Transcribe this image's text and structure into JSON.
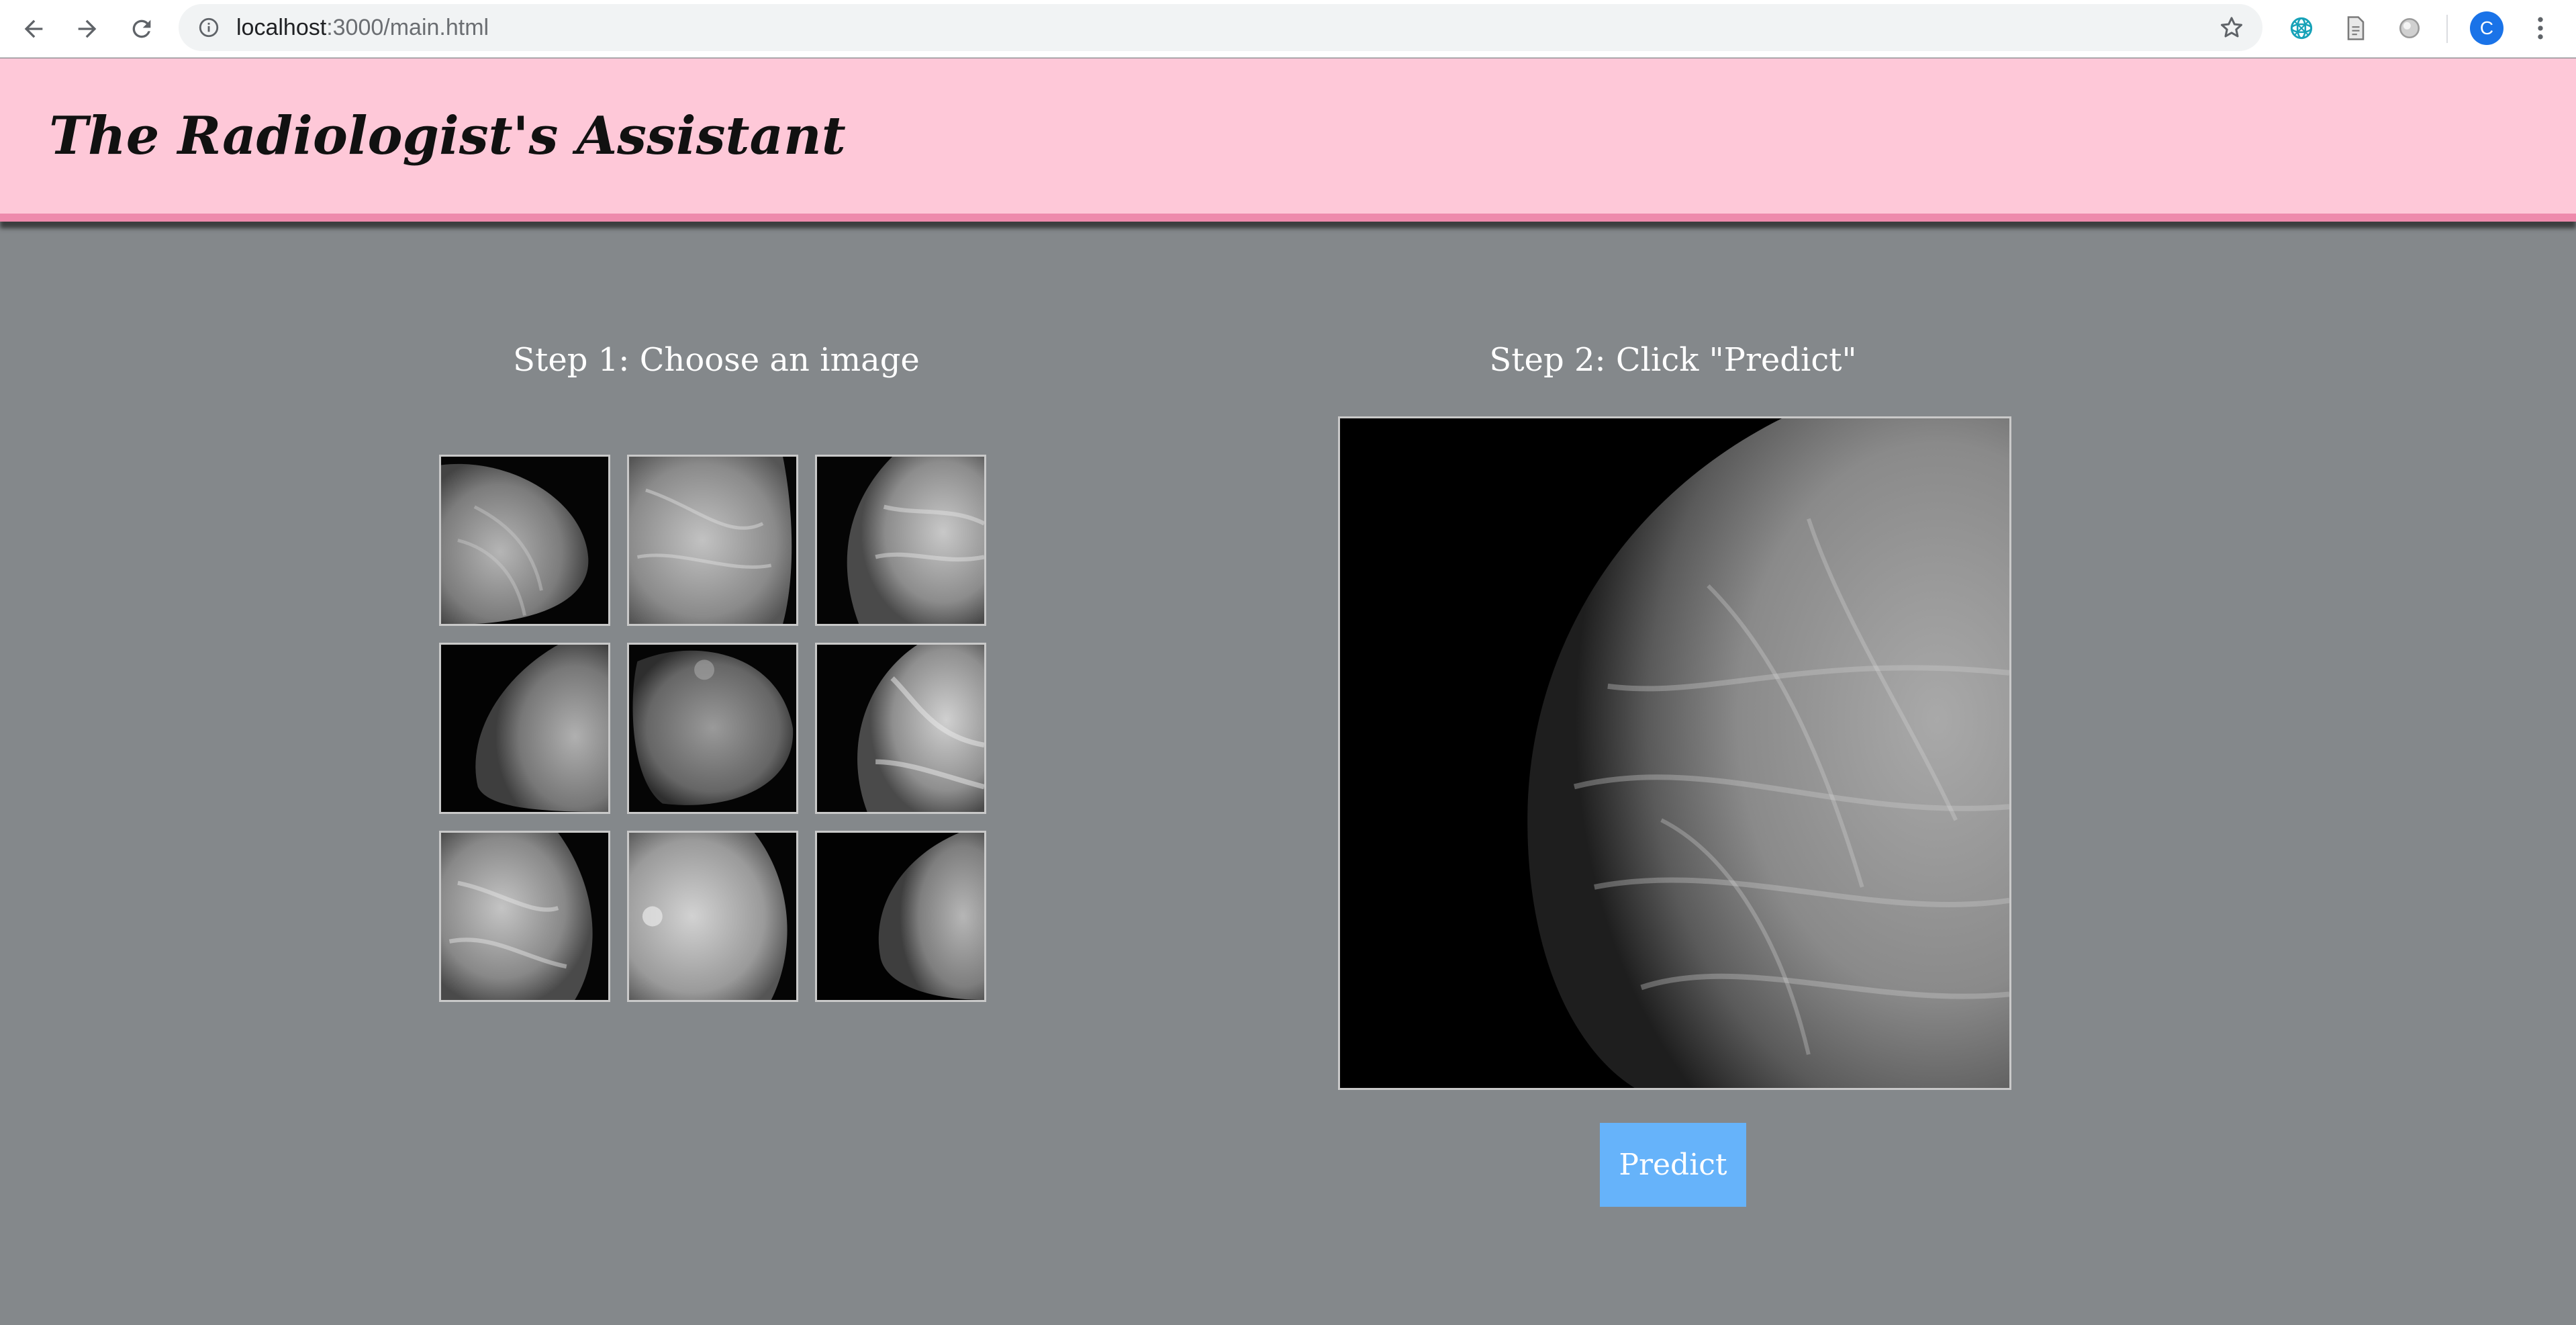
{
  "browser": {
    "url_host": "localhost",
    "url_rest": ":3000/main.html",
    "avatar_letter": "C",
    "icons": [
      "back-arrow-icon",
      "forward-arrow-icon",
      "reload-icon",
      "info-icon",
      "star-icon",
      "extension-icon",
      "document-icon",
      "circle-icon",
      "kebab-menu-icon"
    ]
  },
  "header": {
    "title": "The Radiologist's Assistant",
    "background": "#fec8d8",
    "accent": "#ee8aac"
  },
  "step1": {
    "heading": "Step 1: Choose an image"
  },
  "step2": {
    "heading": "Step 2: Click \"Predict\"",
    "predict_label": "Predict",
    "button_color": "#66b3fa"
  },
  "page": {
    "background": "#84888b"
  }
}
